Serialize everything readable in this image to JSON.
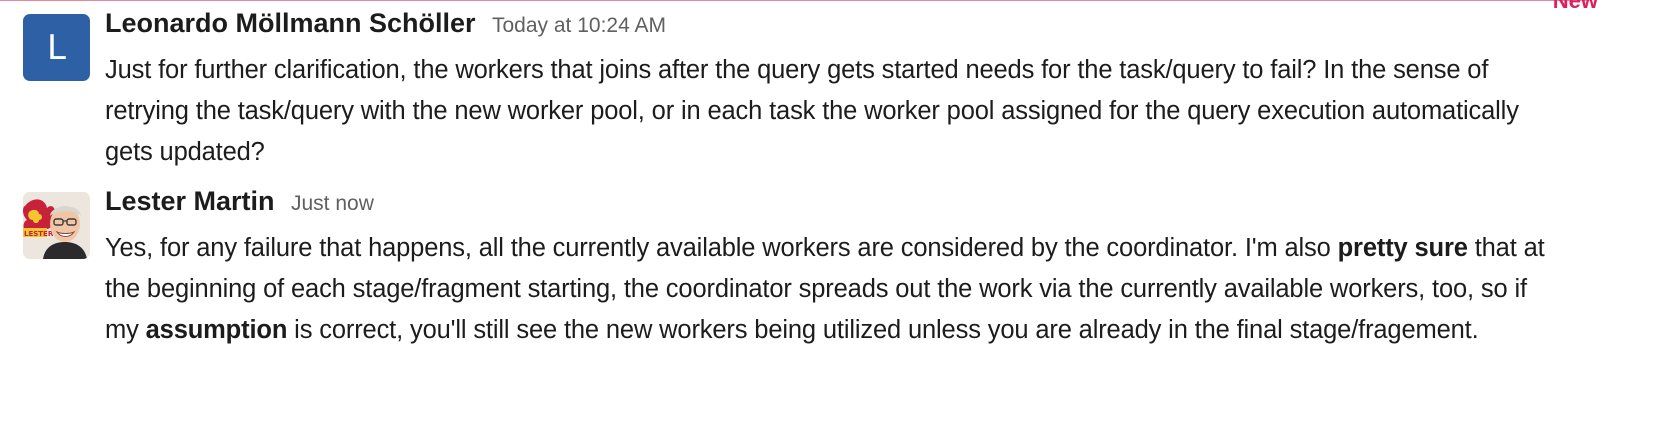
{
  "divider": {
    "label": "New",
    "color": "#e01e5a"
  },
  "messages": [
    {
      "sender": "Leonardo Möllmann Schöller",
      "timestamp": "Today at 10:24 AM",
      "avatar": {
        "type": "letter",
        "letter": "L",
        "color": "#2d60a4"
      },
      "text": "Just for further clarification, the workers that joins after the query gets started needs for the task/query to fail? In the sense of retrying the task/query with the new worker pool, or in each task the worker pool assigned for the query execution automatically gets updated?"
    },
    {
      "sender": "Lester Martin",
      "timestamp": "Just now",
      "avatar": {
        "type": "photo",
        "badge_text": "LESTER"
      },
      "segments": [
        {
          "text": "Yes, for any failure that happens, all the currently available workers are considered by the coordinator.  I'm also ",
          "bold": false
        },
        {
          "text": "pretty sure",
          "bold": true
        },
        {
          "text": " that at the beginning of each stage/fragment starting, the coordinator spreads out the work via the currently available workers, too, so if my ",
          "bold": false
        },
        {
          "text": "assumption",
          "bold": true
        },
        {
          "text": " is correct, you'll still see the new workers being utilized unless you are already in the final stage/fragement.",
          "bold": false
        }
      ]
    }
  ]
}
